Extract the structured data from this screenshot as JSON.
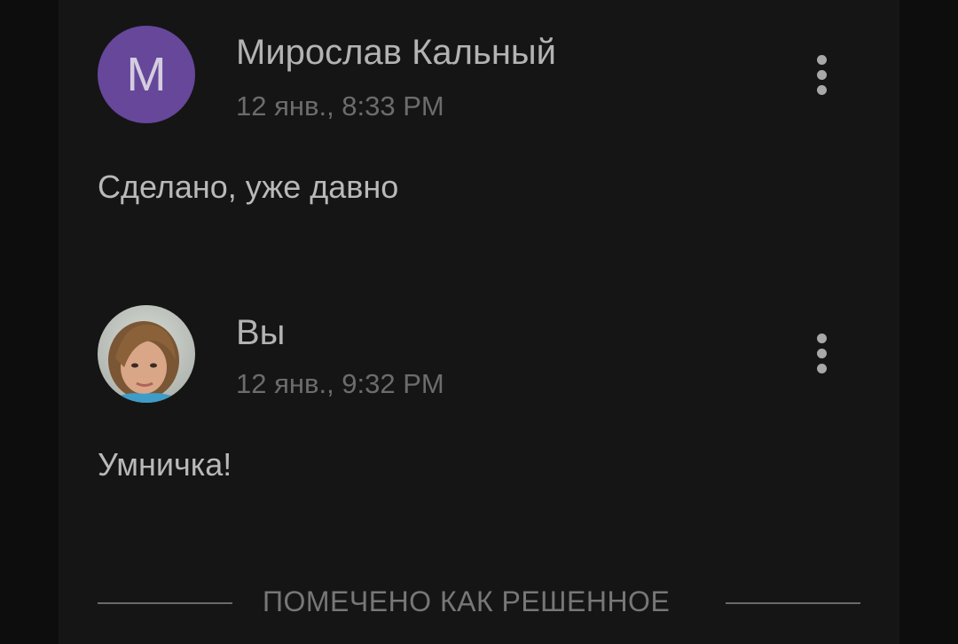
{
  "comments": [
    {
      "avatar_letter": "M",
      "avatar_color": "#66479a",
      "author": "Мирослав Кальный",
      "time": "12 янв., 8:33 PM",
      "text": "Сделано, уже давно",
      "menu_icon": "more-vert-icon"
    },
    {
      "author": "Вы",
      "time": "12 янв., 9:32 PM",
      "text": "Умничка!",
      "menu_icon": "more-vert-icon"
    }
  ],
  "status": {
    "label": "ПОМЕЧЕНО КАК РЕШЕННОЕ"
  },
  "colors": {
    "background": "#151515",
    "author_text": "#b3b3b3",
    "time_text": "#6c6c6c",
    "divider": "#6a6a6a"
  }
}
